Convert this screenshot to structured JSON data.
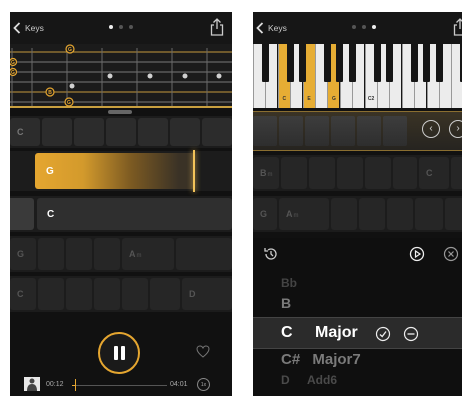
{
  "left": {
    "header": {
      "back_label": "Keys",
      "page_dots": 3,
      "active_dot": 0
    },
    "fretboard": {
      "markers": [
        "G",
        "G",
        "G",
        "B",
        "G"
      ]
    },
    "rows": [
      {
        "cells": [
          {
            "label": "C"
          },
          {
            "label": ""
          },
          {
            "label": ""
          },
          {
            "label": ""
          },
          {
            "label": ""
          },
          {
            "label": ""
          },
          {
            "label": ""
          }
        ]
      },
      {
        "active": "G"
      },
      {
        "next": "C"
      },
      {
        "cells": [
          {
            "label": "G"
          },
          {
            "label": ""
          },
          {
            "label": ""
          },
          {
            "label": "A",
            "sub": "m"
          },
          {
            "label": ""
          },
          {
            "label": ""
          }
        ]
      },
      {
        "cells": [
          {
            "label": "C"
          },
          {
            "label": ""
          },
          {
            "label": ""
          },
          {
            "label": ""
          },
          {
            "label": ""
          },
          {
            "label": "D"
          },
          {
            "label": ""
          }
        ]
      }
    ],
    "transport": {
      "elapsed": "00:12",
      "remaining": "04:01",
      "rate": "1x",
      "progress": 0.047
    }
  },
  "right": {
    "header": {
      "back_label": "Keys",
      "page_dots": 3,
      "active_dot": 2
    },
    "piano": {
      "white_keys": [
        {
          "label": "",
          "hi": false
        },
        {
          "label": "",
          "hi": false
        },
        {
          "label": "C",
          "hi": true
        },
        {
          "label": "",
          "hi": false
        },
        {
          "label": "E",
          "hi": true
        },
        {
          "label": "",
          "hi": false
        },
        {
          "label": "G",
          "hi": true
        },
        {
          "label": "",
          "hi": false
        },
        {
          "label": "",
          "hi": false
        },
        {
          "label": "C2",
          "hi": false
        },
        {
          "label": "",
          "hi": false
        },
        {
          "label": "",
          "hi": false
        },
        {
          "label": "",
          "hi": false
        },
        {
          "label": "",
          "hi": false
        },
        {
          "label": "",
          "hi": false
        },
        {
          "label": "",
          "hi": false
        },
        {
          "label": "",
          "hi": false
        },
        {
          "label": "",
          "hi": false
        }
      ]
    },
    "rows": [
      {
        "cells": [
          {
            "label": "B",
            "sub": "m"
          },
          {
            "label": ""
          },
          {
            "label": ""
          },
          {
            "label": ""
          },
          {
            "label": ""
          },
          {
            "label": ""
          },
          {
            "label": "C"
          },
          {
            "label": ""
          }
        ]
      },
      {
        "cells": [
          {
            "label": "G"
          },
          {
            "label": "A",
            "sub": "m"
          },
          {
            "label": ""
          },
          {
            "label": ""
          },
          {
            "label": ""
          },
          {
            "label": ""
          },
          {
            "label": ""
          }
        ]
      }
    ],
    "picker": {
      "items": [
        {
          "note": "Bb",
          "quality": "",
          "state": "fade"
        },
        {
          "note": "B",
          "quality": "",
          "state": "near"
        },
        {
          "note": "C",
          "quality": "Major",
          "state": "selected"
        },
        {
          "note": "C#",
          "quality": "Major7",
          "state": "near"
        },
        {
          "note": "D",
          "quality": "Add6",
          "state": "fade"
        }
      ]
    }
  }
}
